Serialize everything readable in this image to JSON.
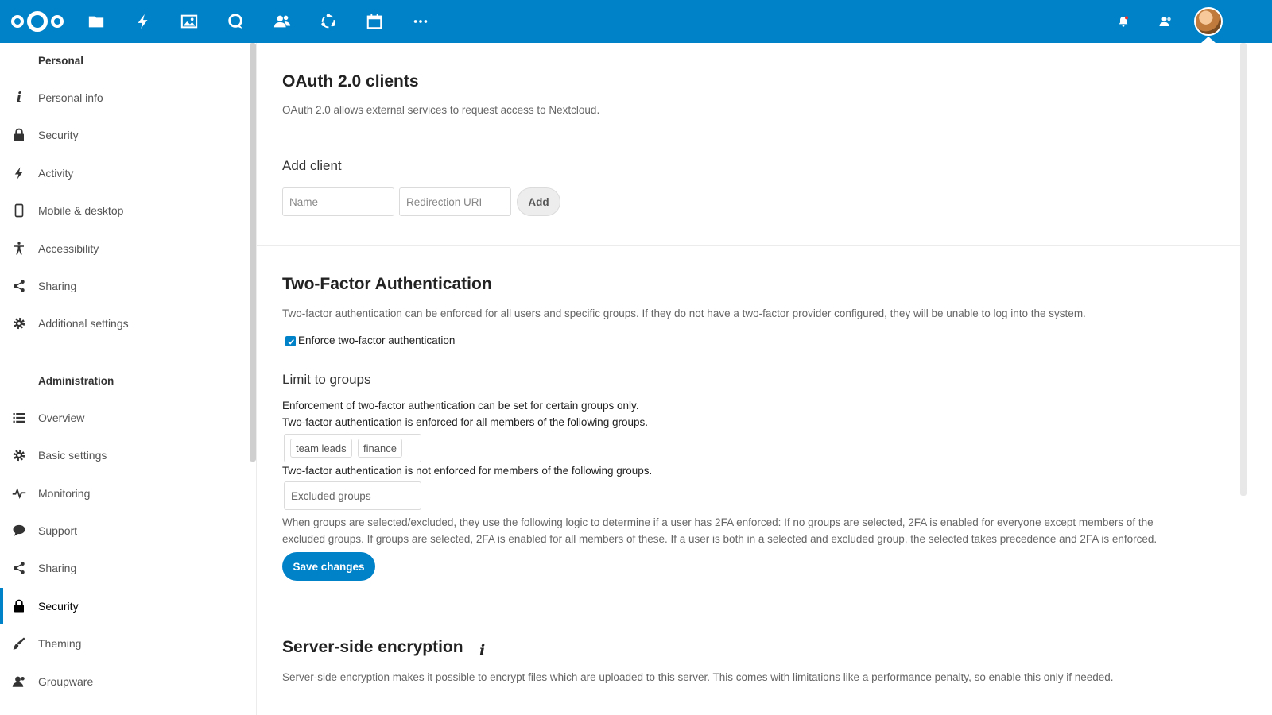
{
  "colors": {
    "primary": "#0082c9"
  },
  "header": {
    "apps": [
      "files-icon",
      "activity-icon",
      "photos-icon",
      "talk-icon",
      "contacts-icon",
      "circles-icon",
      "calendar-icon",
      "more-apps-icon"
    ],
    "right": [
      "notifications-icon",
      "contacts-menu-icon",
      "avatar"
    ]
  },
  "sidebar": {
    "personal_heading": "Personal",
    "personal_items": [
      {
        "label": "Personal info",
        "icon": "info-icon"
      },
      {
        "label": "Security",
        "icon": "lock-icon"
      },
      {
        "label": "Activity",
        "icon": "activity-icon"
      },
      {
        "label": "Mobile & desktop",
        "icon": "phone-icon"
      },
      {
        "label": "Accessibility",
        "icon": "accessibility-icon"
      },
      {
        "label": "Sharing",
        "icon": "share-icon"
      },
      {
        "label": "Additional settings",
        "icon": "gear-icon"
      }
    ],
    "admin_heading": "Administration",
    "admin_items": [
      {
        "label": "Overview",
        "icon": "list-icon"
      },
      {
        "label": "Basic settings",
        "icon": "gear-icon"
      },
      {
        "label": "Monitoring",
        "icon": "monitoring-icon"
      },
      {
        "label": "Support",
        "icon": "chat-icon"
      },
      {
        "label": "Sharing",
        "icon": "share-icon"
      },
      {
        "label": "Security",
        "icon": "lock-icon",
        "active": true
      },
      {
        "label": "Theming",
        "icon": "brush-icon"
      },
      {
        "label": "Groupware",
        "icon": "contacts-icon"
      }
    ]
  },
  "oauth": {
    "title": "OAuth 2.0 clients",
    "description": "OAuth 2.0 allows external services to request access to Nextcloud.",
    "add_client_title": "Add client",
    "name_placeholder": "Name",
    "redirect_placeholder": "Redirection URI",
    "add_button": "Add"
  },
  "twofa": {
    "title": "Two-Factor Authentication",
    "description": "Two-factor authentication can be enforced for all users and specific groups. If they do not have a two-factor provider configured, they will be unable to log into the system.",
    "enforce_label": "Enforce two-factor authentication",
    "enforce_checked": true,
    "limit_title": "Limit to groups",
    "limit_line1": "Enforcement of two-factor authentication can be set for certain groups only.",
    "limit_line2": "Two-factor authentication is enforced for all members of the following groups.",
    "enforced_groups": [
      "team leads",
      "finance"
    ],
    "excluded_line": "Two-factor authentication is not enforced for members of the following groups.",
    "excluded_placeholder": "Excluded groups",
    "logic_line1": "When groups are selected/excluded, they use the following logic to determine if a user has 2FA enforced: If no groups are selected, 2FA is enabled for everyone except members of the",
    "logic_line2": "excluded groups. If groups are selected, 2FA is enabled for all members of these. If a user is both in a selected and excluded group, the selected takes precedence and 2FA is enforced.",
    "save_button": "Save changes"
  },
  "encryption": {
    "title": "Server-side encryption",
    "description": "Server-side encryption makes it possible to encrypt files which are uploaded to this server. This comes with limitations like a performance penalty, so enable this only if needed."
  }
}
